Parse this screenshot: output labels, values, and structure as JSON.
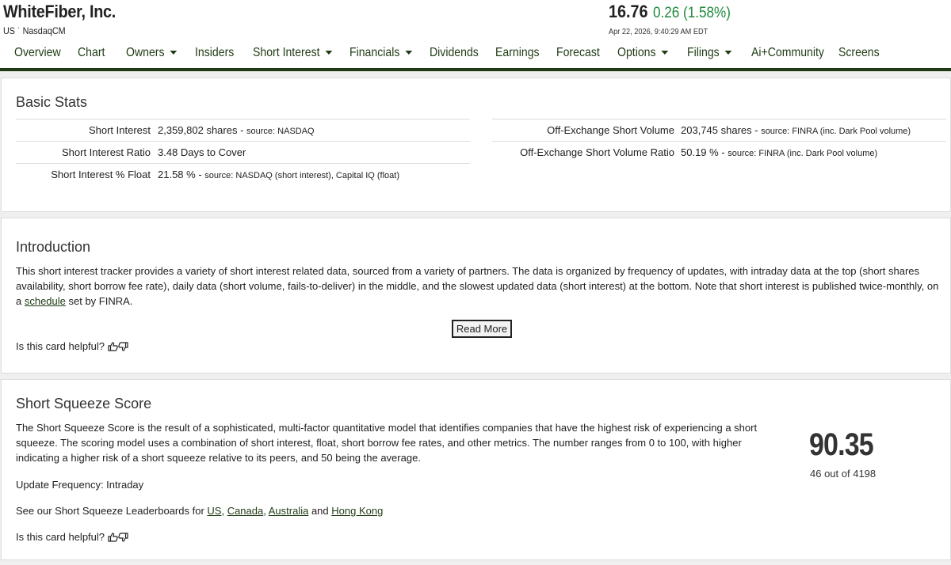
{
  "header": {
    "company": "WhiteFiber, Inc.",
    "exchange": "US ˙ NasdaqCM",
    "price": "16.76",
    "change": "0.26 (1.58%)",
    "timestamp": "Apr 22, 2026, 9:40:29 AM EDT",
    "change_color": "#1e8a3a",
    "brand_color": "#1f3a14"
  },
  "nav": [
    {
      "label": "Overview",
      "dropdown": false
    },
    {
      "label": "Chart",
      "dropdown": false
    },
    {
      "label": "Owners",
      "dropdown": true
    },
    {
      "label": "Insiders",
      "dropdown": false
    },
    {
      "label": "Short Interest",
      "dropdown": true
    },
    {
      "label": "Financials",
      "dropdown": true
    },
    {
      "label": "Dividends",
      "dropdown": false
    },
    {
      "label": "Earnings",
      "dropdown": false
    },
    {
      "label": "Forecast",
      "dropdown": false
    },
    {
      "label": "Options",
      "dropdown": true
    },
    {
      "label": "Filings",
      "dropdown": true
    },
    {
      "label": "Ai+Community",
      "dropdown": false
    },
    {
      "label": "Screens",
      "dropdown": false
    }
  ],
  "basic_stats": {
    "title": "Basic Stats",
    "left": [
      {
        "label": "Short Interest",
        "value": "2,359,802 shares",
        "sep": " - ",
        "source": "source: NASDAQ"
      },
      {
        "label": "Short Interest Ratio",
        "value": "3.48 Days to Cover",
        "sep": "",
        "source": ""
      },
      {
        "label": "Short Interest % Float",
        "value": "21.58 %",
        "sep": " - ",
        "source": "source: NASDAQ (short interest), Capital IQ (float)"
      }
    ],
    "right": [
      {
        "label": "Off-Exchange Short Volume",
        "value": "203,745 shares",
        "sep": " - ",
        "source": "source: FINRA (inc. Dark Pool volume)"
      },
      {
        "label": "Off-Exchange Short Volume Ratio",
        "value": "50.19 %",
        "sep": " - ",
        "source": "source: FINRA (inc. Dark Pool volume)"
      }
    ]
  },
  "introduction": {
    "title": "Introduction",
    "text_before_link": "This short interest tracker provides a variety of short interest related data, sourced from a variety of partners. The data is organized by frequency of updates, with intraday data at the top (short shares availability, short borrow fee rate), daily data (short volume, fails-to-deliver) in the middle, and the slowest updated data (short interest) at the bottom. Note that short interest is published twice-monthly, on a ",
    "link": "schedule",
    "text_after_link": " set by FINRA.",
    "read_more": "Read More",
    "helpful": "Is this card helpful?"
  },
  "squeeze": {
    "title": "Short Squeeze Score",
    "description": "The Short Squeeze Score is the result of a sophisticated, multi-factor quantitative model that identifies companies that have the highest risk of experiencing a short squeeze. The scoring model uses a combination of short interest, float, short borrow fee rates, and other metrics. The number ranges from 0 to 100, with higher indicating a higher risk of a short squeeze relative to its peers, and 50 being the average.",
    "update_frequency": "Update Frequency: Intraday",
    "leaderboard_prefix": "See our Short Squeeze Leaderboards for ",
    "links": [
      "US",
      "Canada",
      "Australia",
      "Hong Kong"
    ],
    "comma": ", ",
    "and": " and ",
    "helpful": "Is this card helpful?",
    "score": "90.35",
    "rank": "46 out of 4198"
  }
}
